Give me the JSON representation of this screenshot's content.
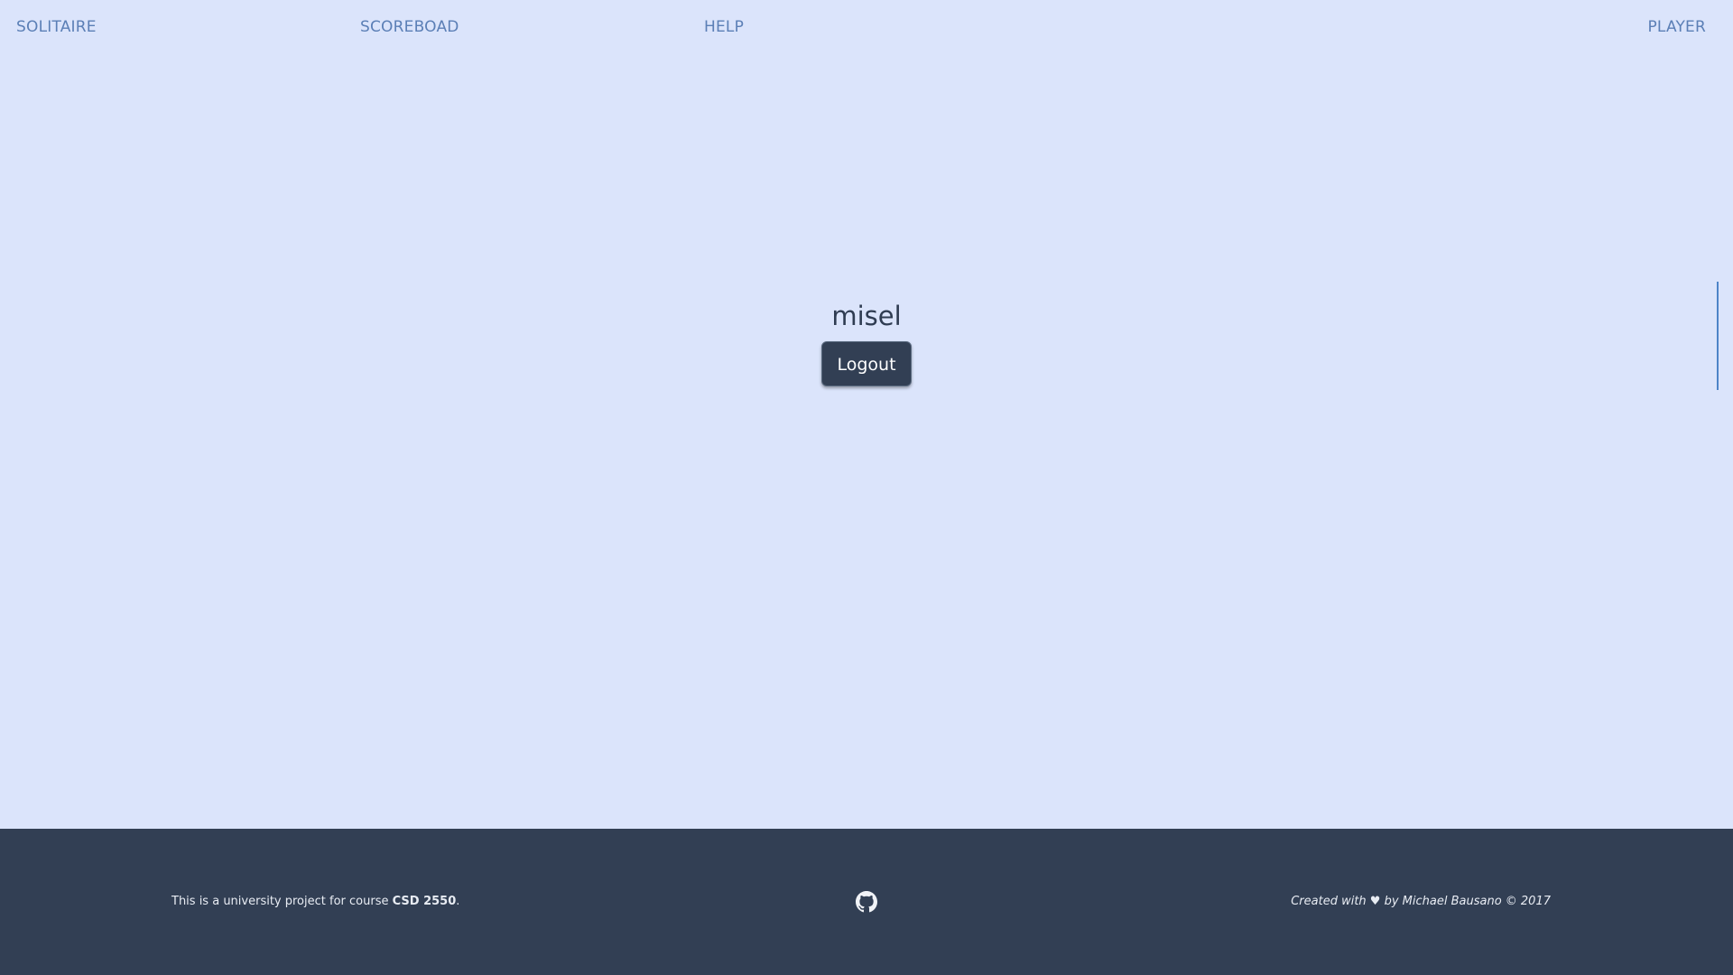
{
  "nav": {
    "items": [
      {
        "label": "SOLITAIRE"
      },
      {
        "label": "SCOREBOAD"
      },
      {
        "label": "HELP"
      },
      {
        "label": "PLAYER"
      }
    ]
  },
  "main": {
    "username": "misel",
    "logout_label": "Logout"
  },
  "footer": {
    "left_text_prefix": "This is a university project for course ",
    "course_code": "CSD 2550",
    "left_text_suffix": ".",
    "right_text": "Created with ♥ by Michael Bausano © 2017",
    "github_icon": "github-icon"
  },
  "colors": {
    "background": "#dbe4fb",
    "nav_link": "#5b7fb6",
    "footer_bg": "#323f54",
    "button_bg": "#323f54",
    "accent_line": "#4d84c8"
  }
}
